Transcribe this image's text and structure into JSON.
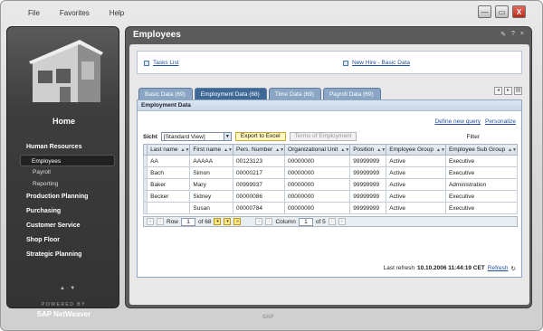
{
  "menu": {
    "file": "File",
    "favorites": "Favorites",
    "help": "Help"
  },
  "window_buttons": {
    "minimize": "—",
    "maximize": "▭",
    "close": "X"
  },
  "left_nav": {
    "home_label": "Home",
    "sections": [
      {
        "label": "Human Resources",
        "subs": [
          "Employees",
          "Payroll",
          "Reporting"
        ]
      },
      {
        "label": "Production Planning"
      },
      {
        "label": "Purchasing"
      },
      {
        "label": "Customer Service"
      },
      {
        "label": "Shop Floor"
      },
      {
        "label": "Strategic Planning"
      }
    ],
    "arrows": "▲ · ▼",
    "powered_by": "POWERED BY",
    "brand": "SAP NetWeaver"
  },
  "main": {
    "title": "Employees",
    "title_icons": [
      "✎",
      "?",
      "×"
    ],
    "quick_links": {
      "tasks": "Tasks List",
      "new_hire": "New Hire - Basic Data"
    },
    "tabs": [
      "Basic Data (69)",
      "Employment Data (68)",
      "Time Data (69)",
      "Payroll Data (69)"
    ],
    "frame_title": "Employment Data",
    "define_query": "Define new query",
    "personalize": "Personalize",
    "sicht_label": "Sicht",
    "sicht_value": "[Standard View]",
    "export_btn": "Export to Excel",
    "terms_btn": "Terms of Employment",
    "filter_label": "Filter",
    "columns": [
      "Last name",
      "First name",
      "Pers. Number",
      "Organizational Unit",
      "Position",
      "Employee Group",
      "Employee Sub Group"
    ],
    "rows": [
      [
        "AA",
        "AAAAA",
        "00123123",
        "00000000",
        "99999999",
        "Active",
        "Executive"
      ],
      [
        "Bach",
        "Simon",
        "00000217",
        "00000000",
        "99999999",
        "Active",
        "Executive"
      ],
      [
        "Baker",
        "Mary",
        "00999937",
        "00000000",
        "99999999",
        "Active",
        "Administration"
      ],
      [
        "Becker",
        "Sidney",
        "00000086",
        "00000000",
        "99999999",
        "Active",
        "Executive"
      ],
      [
        "",
        "Susan",
        "00000784",
        "00000000",
        "99999999",
        "Active",
        "Executive"
      ]
    ],
    "pager": {
      "row_label": "Row",
      "row_value": "1",
      "row_of": "of 68",
      "col_label": "Column",
      "col_value": "1",
      "col_of": "of 5"
    },
    "last_refresh_label": "Last refresh",
    "last_refresh_value": "10.10.2006 11:44:19 CET",
    "refresh_link": "Refresh"
  },
  "footer_logo": "SAP"
}
